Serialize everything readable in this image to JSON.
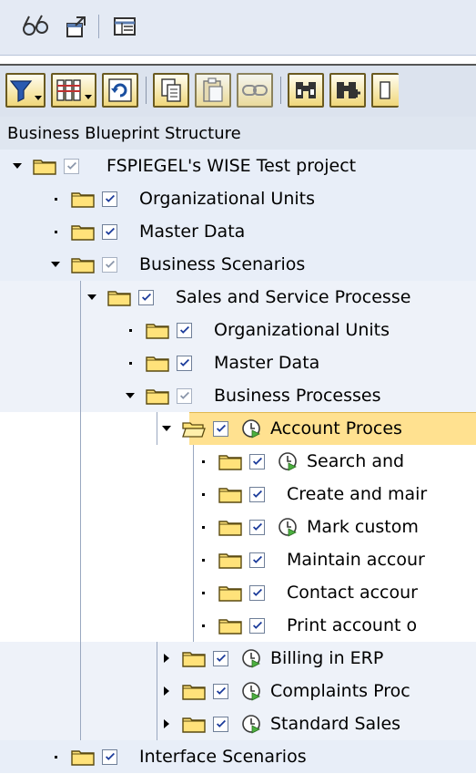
{
  "header": {
    "column_title": "Business Blueprint Structure"
  },
  "top_toolbar": {
    "icons": [
      "glasses-icon",
      "export-icon",
      "list-icon"
    ]
  },
  "tree_toolbar": {
    "icons": [
      "filter-icon",
      "columns-icon",
      "refresh-icon",
      "copy-icon",
      "paste-icon",
      "link-icon",
      "find-icon",
      "find-next-icon",
      "overflow-icon"
    ]
  },
  "tree": {
    "root": {
      "label": "FSPIEGEL's WISE Test project"
    },
    "org_units": {
      "label": "Organizational Units"
    },
    "master_data": {
      "label": "Master Data"
    },
    "business_scenarios": {
      "label": "Business Scenarios"
    },
    "sales_service": {
      "label": "Sales and Service Processe"
    },
    "ss_org_units": {
      "label": "Organizational Units"
    },
    "ss_master_data": {
      "label": "Master Data"
    },
    "business_processes": {
      "label": "Business Processes"
    },
    "account_processing": {
      "label": "Account Proces"
    },
    "search_and": {
      "label": "Search and"
    },
    "create_maint": {
      "label": "Create and mair"
    },
    "mark_customer": {
      "label": "Mark custom"
    },
    "maintain_account": {
      "label": "Maintain accour"
    },
    "contact_account": {
      "label": "Contact accour"
    },
    "print_account": {
      "label": "Print account o"
    },
    "billing_erp": {
      "label": "Billing in ERP"
    },
    "complaints": {
      "label": "Complaints Proc"
    },
    "standard_sales": {
      "label": "Standard Sales"
    },
    "interface_scenarios": {
      "label": "Interface Scenarios"
    }
  },
  "colors": {
    "highlight": "#ffe190",
    "band": "#e8eef8",
    "folder": "#ffe27a",
    "check": "#1a3a9a"
  }
}
